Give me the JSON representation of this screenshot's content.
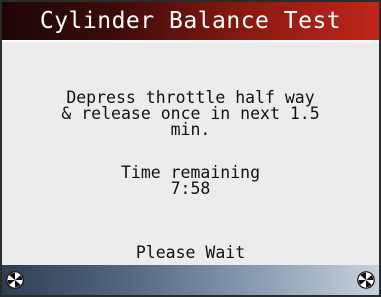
{
  "header": {
    "title": "Cylinder Balance Test"
  },
  "main": {
    "instruction_lines": [
      "Depress throttle half way",
      "& release once in next 1.5",
      "min."
    ],
    "timer_label": "Time remaining",
    "timer_value": "7:58",
    "status": "Please Wait"
  },
  "footer": {
    "left_icon": "navigation-ball-icon",
    "right_icon": "navigation-ball-icon"
  },
  "colors": {
    "title_gradient_start": "#1e0606",
    "title_gradient_end": "#c0261b",
    "body_background": "#ececec",
    "footer_gradient_start": "#2e3d52",
    "footer_gradient_end": "#c9d1dc"
  }
}
